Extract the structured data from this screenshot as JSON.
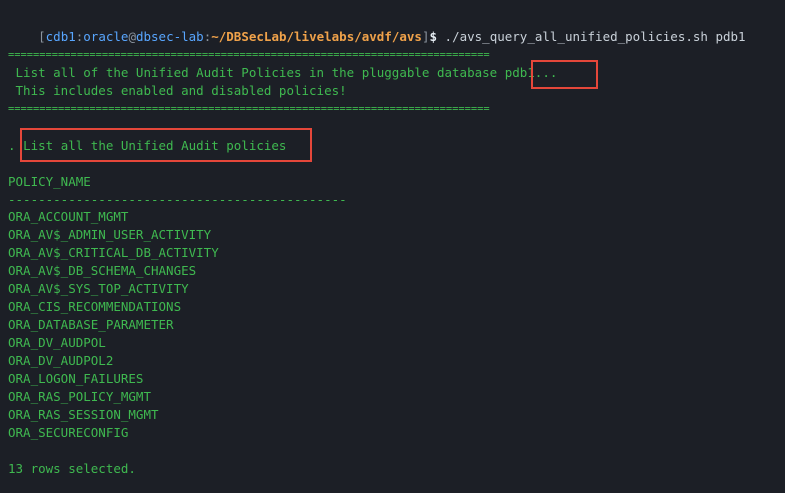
{
  "prompt": {
    "open_bracket": "[",
    "user": "cdb1",
    "sep1": ":",
    "user2": "oracle",
    "at": "@",
    "host": "dbsec-lab",
    "sep2": ":",
    "path": "~/DBSecLab/livelabs/avdf/avs",
    "close_bracket": "]",
    "dollar": "$",
    "command": " ./avs_query_all_unified_policies.sh pdb1"
  },
  "banner": {
    "rule": "=============================================================================",
    "line1_prefix": " List all of the Unified Audit Policies in the pluggable database ",
    "line1_db": "pdb1...",
    "line2": " This includes enabled and disabled policies!"
  },
  "section": {
    "dot": ". ",
    "title": "List all the Unified Audit policies"
  },
  "table": {
    "header": "POLICY_NAME",
    "underline": "---------------------------------------------",
    "rows": [
      "ORA_ACCOUNT_MGMT",
      "ORA_AV$_ADMIN_USER_ACTIVITY",
      "ORA_AV$_CRITICAL_DB_ACTIVITY",
      "ORA_AV$_DB_SCHEMA_CHANGES",
      "ORA_AV$_SYS_TOP_ACTIVITY",
      "ORA_CIS_RECOMMENDATIONS",
      "ORA_DATABASE_PARAMETER",
      "ORA_DV_AUDPOL",
      "ORA_DV_AUDPOL2",
      "ORA_LOGON_FAILURES",
      "ORA_RAS_POLICY_MGMT",
      "ORA_RAS_SESSION_MGMT",
      "ORA_SECURECONFIG"
    ]
  },
  "footer": "13 rows selected.",
  "colors": {
    "background": "#1c1f26",
    "output_text": "#3fb950",
    "highlight_box": "#e5473a",
    "prompt_user": "#58a6ff",
    "prompt_path": "#f0a24a"
  }
}
